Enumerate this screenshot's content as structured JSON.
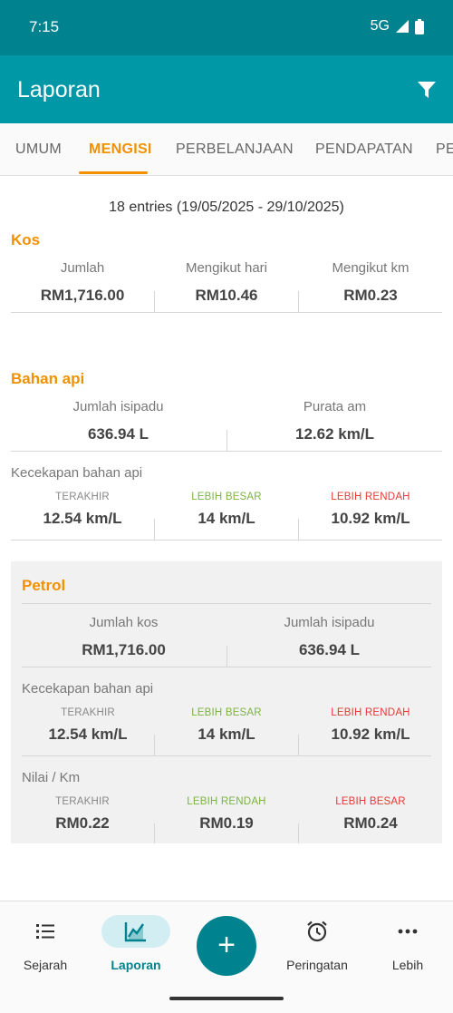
{
  "status_bar": {
    "time": "7:15",
    "network": "5G"
  },
  "appbar": {
    "title": "Laporan"
  },
  "tabs": [
    "UMUM",
    "MENGISI",
    "PERBELANJAAN",
    "PENDAPATAN",
    "PE"
  ],
  "summary": "18 entries (19/05/2025 - 29/10/2025)",
  "kos": {
    "title": "Kos",
    "total_label": "Jumlah",
    "total_value": "RM1,716.00",
    "per_day_label": "Mengikut hari",
    "per_day_value": "RM10.46",
    "per_km_label": "Mengikut km",
    "per_km_value": "RM0.23"
  },
  "bahan_api": {
    "title": "Bahan api",
    "volume_label": "Jumlah isipadu",
    "volume_value": "636.94 L",
    "avg_label": "Purata am",
    "avg_value": "12.62 km/L",
    "efficiency_title": "Kecekapan bahan api",
    "last_label": "TERAKHIR",
    "last_value": "12.54 km/L",
    "higher_label": "LEBIH BESAR",
    "higher_value": "14 km/L",
    "lower_label": "LEBIH RENDAH",
    "lower_value": "10.92 km/L"
  },
  "petrol": {
    "title": "Petrol",
    "cost_label": "Jumlah kos",
    "cost_value": "RM1,716.00",
    "volume_label": "Jumlah isipadu",
    "volume_value": "636.94 L",
    "efficiency_title": "Kecekapan bahan api",
    "eff_last_label": "TERAKHIR",
    "eff_last_value": "12.54 km/L",
    "eff_higher_label": "LEBIH BESAR",
    "eff_higher_value": "14 km/L",
    "eff_lower_label": "LEBIH RENDAH",
    "eff_lower_value": "10.92 km/L",
    "per_km_title": "Nilai / Km",
    "pk_last_label": "TERAKHIR",
    "pk_last_value": "RM0.22",
    "pk_lower_label": "LEBIH RENDAH",
    "pk_lower_value": "RM0.19",
    "pk_higher_label": "LEBIH BESAR",
    "pk_higher_value": "RM0.24"
  },
  "bottom_nav": {
    "history": "Sejarah",
    "reports": "Laporan",
    "add": "+",
    "reminders": "Peringatan",
    "more": "Lebih"
  },
  "colors": {
    "accent": "#f29100",
    "primary": "#0097a7",
    "primary_dark": "#00838f",
    "green": "#7cb342",
    "red": "#e53935"
  },
  "icons": [
    "signal-icon",
    "battery-icon",
    "filter-icon",
    "list-icon",
    "chart-icon",
    "plus-icon",
    "alarm-icon",
    "more-icon"
  ]
}
